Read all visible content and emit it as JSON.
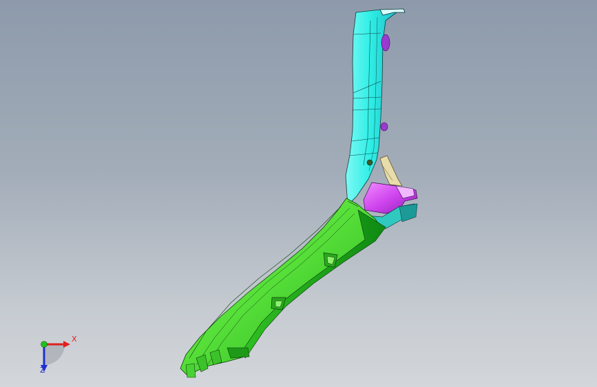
{
  "viewport": {
    "background_top": "#8d9aab",
    "background_bottom": "#d3d6da"
  },
  "model": {
    "parts": [
      {
        "name": "upper-pillar",
        "color": "#2fefe6"
      },
      {
        "name": "lower-trim",
        "color": "#55e23a"
      },
      {
        "name": "bracket",
        "color": "#cf44ee"
      },
      {
        "name": "clip",
        "color": "#e8dcaa"
      },
      {
        "name": "lower-clip",
        "color": "#2fc9c0"
      }
    ]
  },
  "triad": {
    "x_label": "X",
    "z_label": "Z",
    "x_color": "#e02020",
    "y_color": "#20c020",
    "z_color": "#2030d0"
  }
}
